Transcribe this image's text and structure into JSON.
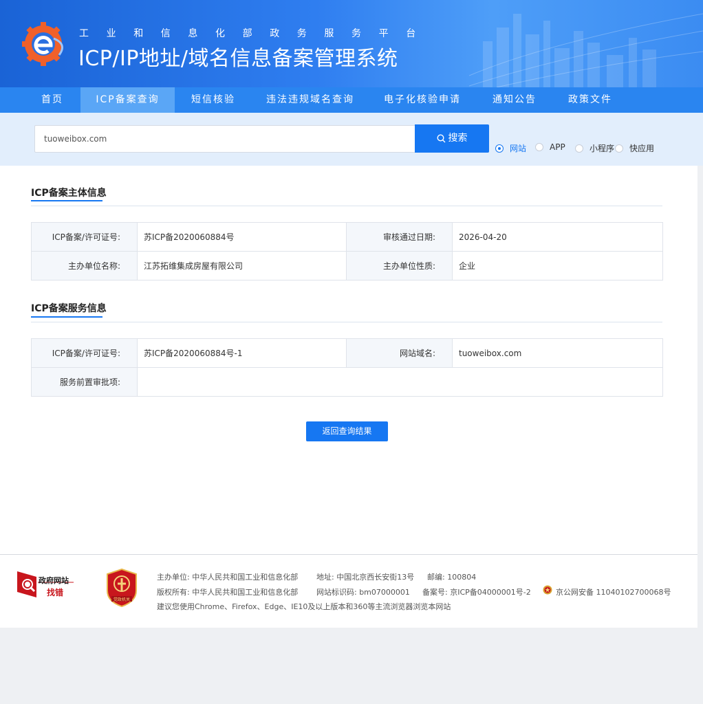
{
  "header": {
    "subtitle": "工业和信息化部政务服务平台",
    "title": "ICP/IP地址/域名信息备案管理系统"
  },
  "nav": {
    "items": [
      {
        "label": "首页"
      },
      {
        "label": "ICP备案查询",
        "active": true
      },
      {
        "label": "短信核验"
      },
      {
        "label": "违法违规域名查询"
      },
      {
        "label": "电子化核验申请"
      },
      {
        "label": "通知公告"
      },
      {
        "label": "政策文件"
      }
    ]
  },
  "search": {
    "value": "tuoweibox.com",
    "button_label": "搜索",
    "types": [
      {
        "label": "网站",
        "checked": true
      },
      {
        "label": "APP",
        "checked": false
      },
      {
        "label": "小程序",
        "checked": false
      },
      {
        "label": "快应用",
        "checked": false
      }
    ]
  },
  "subject_info": {
    "title": "ICP备案主体信息",
    "license_label": "ICP备案/许可证号:",
    "license_value": "苏ICP备2020060884号",
    "approve_date_label": "审核通过日期:",
    "approve_date_value": "2026-04-20",
    "org_name_label": "主办单位名称:",
    "org_name_value": "江苏拓维集成房屋有限公司",
    "org_type_label": "主办单位性质:",
    "org_type_value": "企业"
  },
  "service_info": {
    "title": "ICP备案服务信息",
    "license_label": "ICP备案/许可证号:",
    "license_value": "苏ICP备2020060884号-1",
    "domain_label": "网站域名:",
    "domain_value": "tuoweibox.com",
    "pre_approval_label": "服务前置审批项:",
    "pre_approval_value": ""
  },
  "back_button": "返回查询结果",
  "footer": {
    "gov_site_label": "政府网站",
    "gov_error_label": "找错",
    "badge_label": "党政机关",
    "row1": {
      "sponsor": "主办单位: 中华人民共和国工业和信息化部",
      "address": "地址: 中国北京西长安街13号",
      "postcode": "邮编: 100804"
    },
    "row2": {
      "copyright": "版权所有: 中华人民共和国工业和信息化部",
      "site_id": "网站标识码: bm07000001",
      "record": "备案号: 京ICP备04000001号-2",
      "police_record": "京公网安备 11040102700068号"
    },
    "row3": "建议您使用Chrome、Firefox、Edge、IE10及以上版本和360等主流浏览器浏览本网站"
  },
  "colors": {
    "primary": "#1677f2",
    "nav_bg": "#2a85f0",
    "nav_active": "#5aa6f6",
    "search_band": "#e2eefc",
    "logo_orange": "#f0602a",
    "footer_red": "#c8161d"
  }
}
